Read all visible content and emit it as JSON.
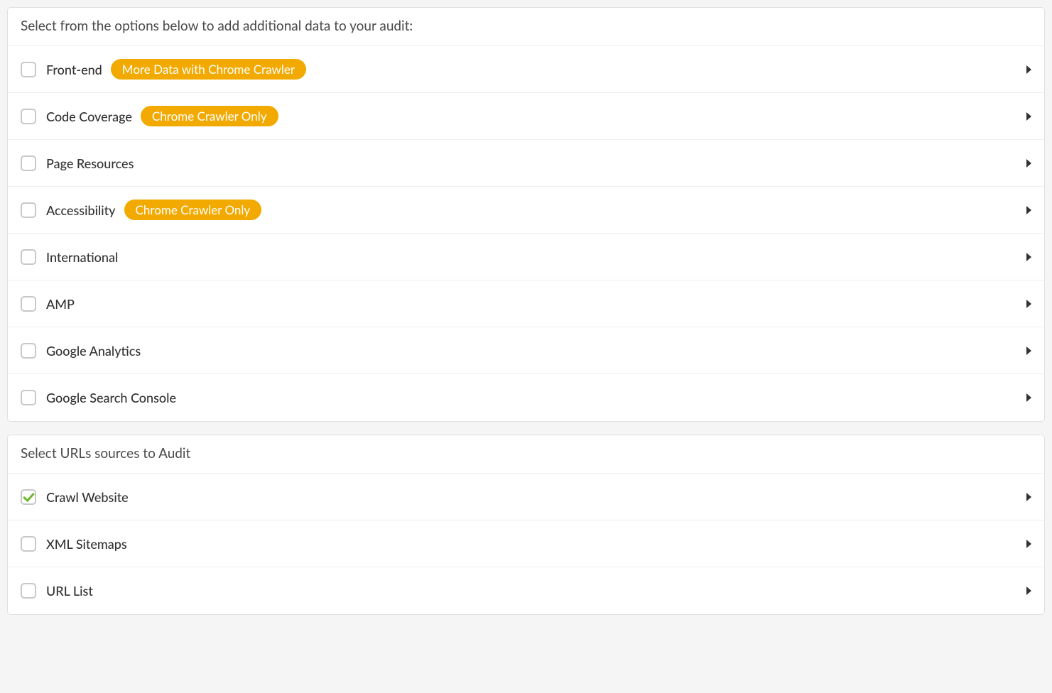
{
  "section1": {
    "title": "Select from the options below to add additional data to your audit:",
    "items": [
      {
        "label": "Front-end",
        "badge": "More Data with Chrome Crawler",
        "checked": false
      },
      {
        "label": "Code Coverage",
        "badge": "Chrome Crawler Only",
        "checked": false
      },
      {
        "label": "Page Resources",
        "badge": null,
        "checked": false
      },
      {
        "label": "Accessibility",
        "badge": "Chrome Crawler Only",
        "checked": false
      },
      {
        "label": "International",
        "badge": null,
        "checked": false
      },
      {
        "label": "AMP",
        "badge": null,
        "checked": false
      },
      {
        "label": "Google Analytics",
        "badge": null,
        "checked": false
      },
      {
        "label": "Google Search Console",
        "badge": null,
        "checked": false
      }
    ]
  },
  "section2": {
    "title": "Select URLs sources to Audit",
    "items": [
      {
        "label": "Crawl Website",
        "badge": null,
        "checked": true
      },
      {
        "label": "XML Sitemaps",
        "badge": null,
        "checked": false
      },
      {
        "label": "URL List",
        "badge": null,
        "checked": false
      }
    ]
  }
}
